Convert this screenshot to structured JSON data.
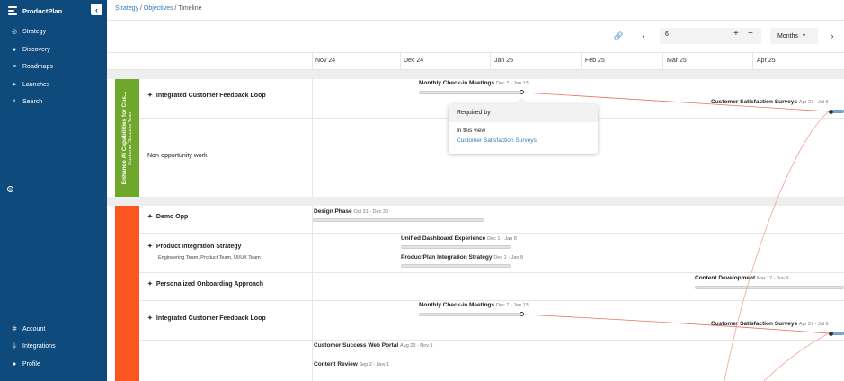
{
  "sidebar": {
    "brand": "ProductPlan",
    "collapse_icon": "chevron-left-icon",
    "color": "#0f4a7c",
    "items": [
      {
        "label": "Strategy",
        "icon": "target-icon",
        "glyph": "◎"
      },
      {
        "label": "Discovery",
        "icon": "lightbulb-icon",
        "glyph": "●"
      },
      {
        "label": "Roadmaps",
        "icon": "list-icon",
        "glyph": "≡"
      },
      {
        "label": "Launches",
        "icon": "rocket-icon",
        "glyph": "➤"
      },
      {
        "label": "Search",
        "icon": "search-icon",
        "glyph": "⌕"
      }
    ],
    "bottom_items": [
      {
        "label": "Account",
        "icon": "gear-icon",
        "glyph": "✲"
      },
      {
        "label": "Integrations",
        "icon": "plug-icon",
        "glyph": "⏚"
      },
      {
        "label": "Profile",
        "icon": "user-icon",
        "glyph": "●"
      }
    ]
  },
  "breadcrumb": {
    "strategy": "Strategy",
    "separator": " / ",
    "objectives": "Objectives",
    "current": "Timeline"
  },
  "toolbar": {
    "link_icon": "link-icon",
    "zoom_value": "6",
    "plus": "+",
    "minus": "−",
    "time_unit": "Months"
  },
  "timeline": {
    "months": [
      "Nov 24",
      "Dec 24",
      "Jan 25",
      "Feb 25",
      "Mar 25",
      "Apr 25"
    ]
  },
  "groups": [
    {
      "title": "Enhance AI Capabilities for Cus...",
      "subtitle": "Customer Success Team",
      "color": "#6fa62c",
      "rows": [
        {
          "label": "Integrated Customer Feedback Loop",
          "bars": [
            {
              "name": "Monthly Check-in Meetings",
              "dates": "Dec 7 - Jan 13"
            },
            {
              "name": "Customer Satisfaction Surveys",
              "dates": "Apr 27 - Jul 6"
            }
          ]
        },
        {
          "label": "Non-opportunity work"
        }
      ]
    },
    {
      "color": "#fb5620",
      "rows": [
        {
          "label": "Demo Opp",
          "bars": [
            {
              "name": "Design Phase",
              "dates": "Oct 31 - Dec 30"
            }
          ]
        },
        {
          "label": "Product Integration Strategy",
          "sub": "Engineering Team, Product Team, UI/UX Team",
          "bars": [
            {
              "name": "Unified Dashboard Experience",
              "dates": "Dec 1 - Jan 8"
            },
            {
              "name": "ProductPlan Integration Strategy",
              "dates": "Dec 1 - Jan 8"
            }
          ]
        },
        {
          "label": "Personalized Onboarding Approach",
          "bars": [
            {
              "name": "Content Development",
              "dates": "Mar 12 - Jun 9"
            }
          ]
        },
        {
          "label": "Integrated Customer Feedback Loop",
          "bars": [
            {
              "name": "Monthly Check-in Meetings",
              "dates": "Dec 7 - Jan 13"
            },
            {
              "name": "Customer Satisfaction Surveys",
              "dates": "Apr 27 - Jul 6"
            }
          ]
        },
        {
          "bars": [
            {
              "name": "Customer Success Web Portal",
              "dates": "Aug 23 - Nov 1"
            },
            {
              "name": "Content Review",
              "dates": "Sep 2 - Nov 1"
            }
          ]
        }
      ]
    }
  ],
  "popover": {
    "title": "Required by",
    "subtitle": "In this view",
    "link": "Customer Satisfaction Surveys"
  },
  "colors": {
    "accent": "#2f7cbf",
    "dependency_line": "#e8735f"
  }
}
